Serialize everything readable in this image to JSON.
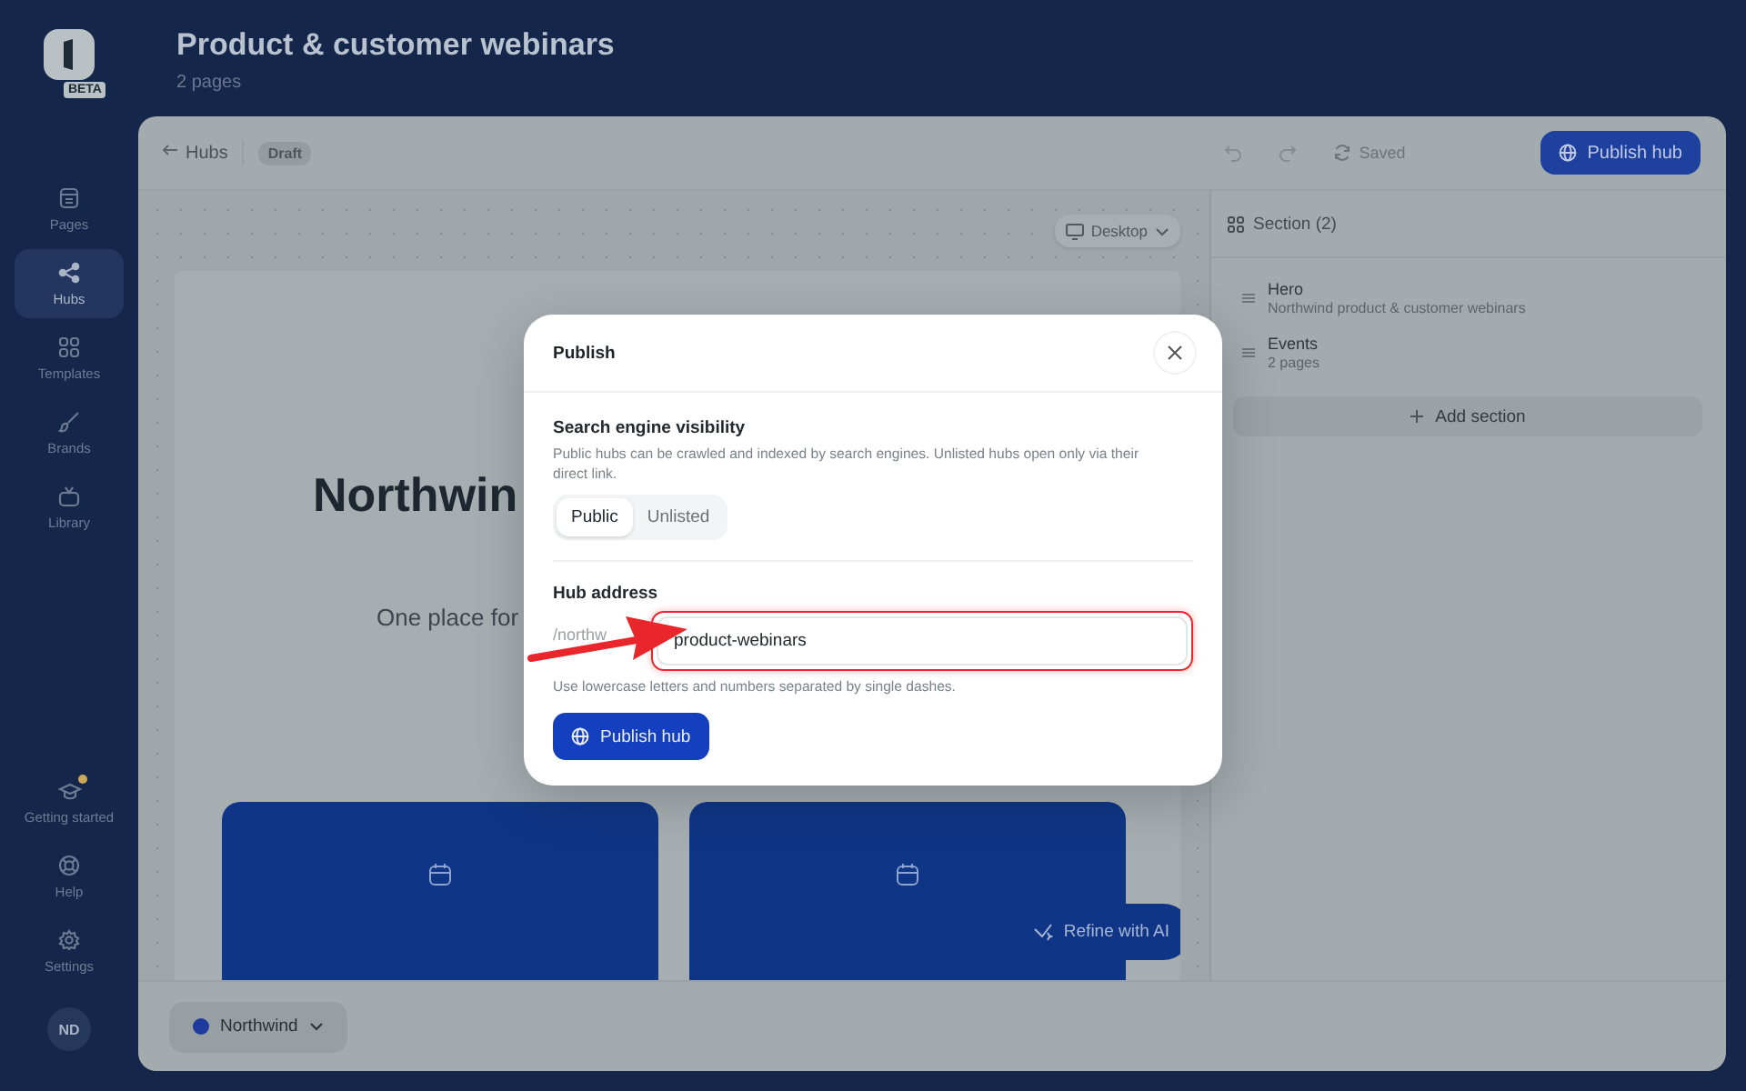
{
  "logo": {
    "badge": "BETA"
  },
  "sidebar": {
    "items": [
      {
        "label": "Pages",
        "kind": "pages",
        "selected": false
      },
      {
        "label": "Hubs",
        "kind": "hubs",
        "selected": true
      },
      {
        "label": "Templates",
        "kind": "templates",
        "selected": false
      },
      {
        "label": "Brands",
        "kind": "brands",
        "selected": false
      },
      {
        "label": "Library",
        "kind": "library",
        "selected": false
      }
    ],
    "bottom_items": [
      {
        "label": "Getting started",
        "kind": "start",
        "notification": true
      },
      {
        "label": "Help",
        "kind": "help",
        "notification": false
      },
      {
        "label": "Settings",
        "kind": "settings",
        "notification": false
      }
    ],
    "avatar": "ND"
  },
  "header": {
    "title": "Product & customer webinars",
    "subtitle": "2 pages"
  },
  "toolbar": {
    "back": "Hubs",
    "status": "Draft",
    "saved": "Saved",
    "publish": "Publish hub"
  },
  "canvas": {
    "device": "Desktop",
    "hero_title": "Northwin",
    "hero_subtitle": "One place for",
    "refine": "Refine with AI"
  },
  "sections": {
    "title": "Section (2)",
    "items": [
      {
        "name": "Hero",
        "detail": "Northwind product & customer webinars"
      },
      {
        "name": "Events",
        "detail": "2 pages"
      }
    ],
    "add": "Add section"
  },
  "brand_selector": {
    "label": "Northwind"
  },
  "modal": {
    "title": "Publish",
    "visibility_heading": "Search engine visibility",
    "visibility_text": "Public hubs can be crawled and indexed by search engines. Unlisted hubs open only via their direct link.",
    "options": [
      {
        "label": "Public",
        "selected": true
      },
      {
        "label": "Unlisted",
        "selected": false
      }
    ],
    "address_label": "Hub address",
    "prefix": "/northw",
    "value": "product-webinars",
    "highlighted": true,
    "hint": "Use lowercase letters and numbers separated by single dashes.",
    "button": "Publish hub"
  }
}
